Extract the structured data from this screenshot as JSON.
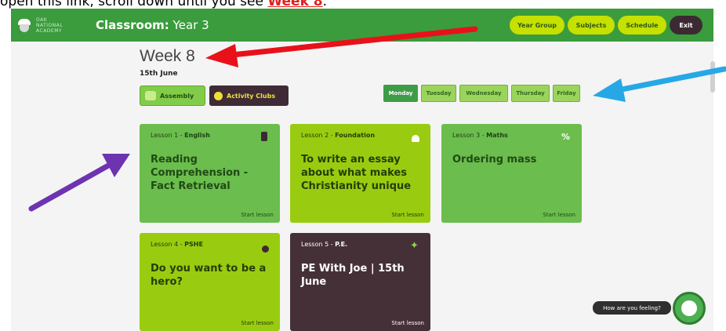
{
  "instruction": {
    "prefix": "open this link, scroll down until you see ",
    "link_text": "Week 8",
    "suffix": "."
  },
  "header": {
    "logo_text": "OAK NATIONAL ACADEMY",
    "classroom_label": "Classroom:",
    "classroom_value": "Year 3",
    "nav": [
      "Year Group",
      "Subjects",
      "Schedule"
    ],
    "exit": "Exit"
  },
  "week": {
    "title": "Week 8",
    "date": "15th June"
  },
  "tabs": {
    "assembly": "Assembly",
    "clubs": "Activity Clubs"
  },
  "days": [
    "Monday",
    "Tuesday",
    "Wednesday",
    "Thursday",
    "Friday"
  ],
  "active_day": "Monday",
  "lessons": [
    {
      "num": "Lesson 1 - ",
      "subject": "English",
      "title": "Reading Comprehension - Fact Retrieval",
      "start": "Start lesson"
    },
    {
      "num": "Lesson 2 - ",
      "subject": "Foundation",
      "title": "To write an essay about what makes Christianity unique",
      "start": "Start lesson"
    },
    {
      "num": "Lesson 3 - ",
      "subject": "Maths",
      "title": "Ordering mass",
      "start": "Start lesson"
    },
    {
      "num": "Lesson 4 - ",
      "subject": "PSHE",
      "title": "Do you want to be a hero?",
      "start": "Start lesson"
    },
    {
      "num": "Lesson 5 - ",
      "subject": "P.E.",
      "title": "PE With Joe | 15th June",
      "start": "Start lesson"
    }
  ],
  "feeling": "How are you feeling?",
  "colors": {
    "header_green": "#3a9c3c",
    "nav_lime": "#c6e000",
    "card_green": "#6bbd4d",
    "card_lime": "#99cc10",
    "card_purple": "#463038",
    "arrow_red": "#e8111a",
    "arrow_blue": "#26a8e6",
    "arrow_purple": "#6e33b0"
  }
}
